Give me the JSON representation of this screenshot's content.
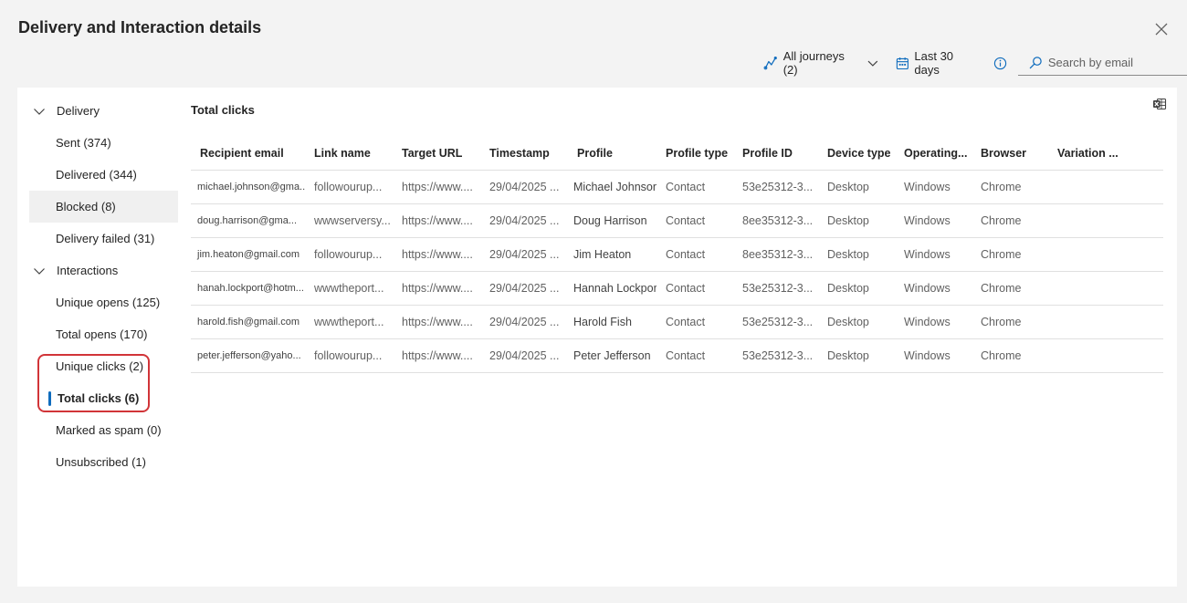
{
  "dialog": {
    "title": "Delivery and Interaction details"
  },
  "filters": {
    "journeys_label": "All journeys (2)",
    "date_label": "Last 30 days",
    "search_placeholder": "Search by email"
  },
  "nav": {
    "groups": [
      {
        "label": "Delivery",
        "items": [
          {
            "label": "Sent (374)"
          },
          {
            "label": "Delivered (344)"
          },
          {
            "label": "Blocked (8)"
          },
          {
            "label": "Delivery failed (31)"
          }
        ]
      },
      {
        "label": "Interactions",
        "items": [
          {
            "label": "Unique opens (125)"
          },
          {
            "label": "Total opens (170)"
          },
          {
            "label": "Unique clicks (2)"
          },
          {
            "label": "Total clicks (6)"
          },
          {
            "label": "Marked as spam (0)"
          },
          {
            "label": "Unsubscribed (1)"
          }
        ]
      }
    ]
  },
  "main": {
    "section_title": "Total clicks",
    "columns": [
      "Recipient email",
      "Link name",
      "Target URL",
      "Timestamp",
      "Profile",
      "Profile type",
      "Profile ID",
      "Device type",
      "Operating...",
      "Browser",
      "Variation ..."
    ],
    "rows": [
      [
        "michael.johnson@gma...",
        "followourup...",
        "https://www....",
        "29/04/2025 ...",
        "Michael Johnson",
        "Contact",
        "53e25312-3...",
        "Desktop",
        "Windows",
        "Chrome",
        ""
      ],
      [
        "doug.harrison@gma...",
        "wwwserversy...",
        "https://www....",
        "29/04/2025 ...",
        "Doug Harrison",
        "Contact",
        "8ee35312-3...",
        "Desktop",
        "Windows",
        "Chrome",
        ""
      ],
      [
        "jim.heaton@gmail.com",
        "followourup...",
        "https://www....",
        "29/04/2025 ...",
        "Jim Heaton",
        "Contact",
        "8ee35312-3...",
        "Desktop",
        "Windows",
        "Chrome",
        ""
      ],
      [
        "hanah.lockport@hotm...",
        "wwwtheport...",
        "https://www....",
        "29/04/2025 ...",
        "Hannah Lockport",
        "Contact",
        "53e25312-3...",
        "Desktop",
        "Windows",
        "Chrome",
        ""
      ],
      [
        "harold.fish@gmail.com",
        "wwwtheport...",
        "https://www....",
        "29/04/2025 ...",
        "Harold Fish",
        "Contact",
        "53e25312-3...",
        "Desktop",
        "Windows",
        "Chrome",
        ""
      ],
      [
        "peter.jefferson@yaho...",
        "followourup...",
        "https://www....",
        "29/04/2025 ...",
        "Peter Jefferson",
        "Contact",
        "53e25312-3...",
        "Desktop",
        "Windows",
        "Chrome",
        ""
      ]
    ]
  },
  "icons": {
    "close": "close-icon",
    "journeys": "journey-icon",
    "calendar": "calendar-icon",
    "info": "info-icon",
    "search": "search-icon",
    "export": "excel-export-icon"
  },
  "colors": {
    "accent": "#0f6cbd",
    "highlight": "#d13438"
  }
}
